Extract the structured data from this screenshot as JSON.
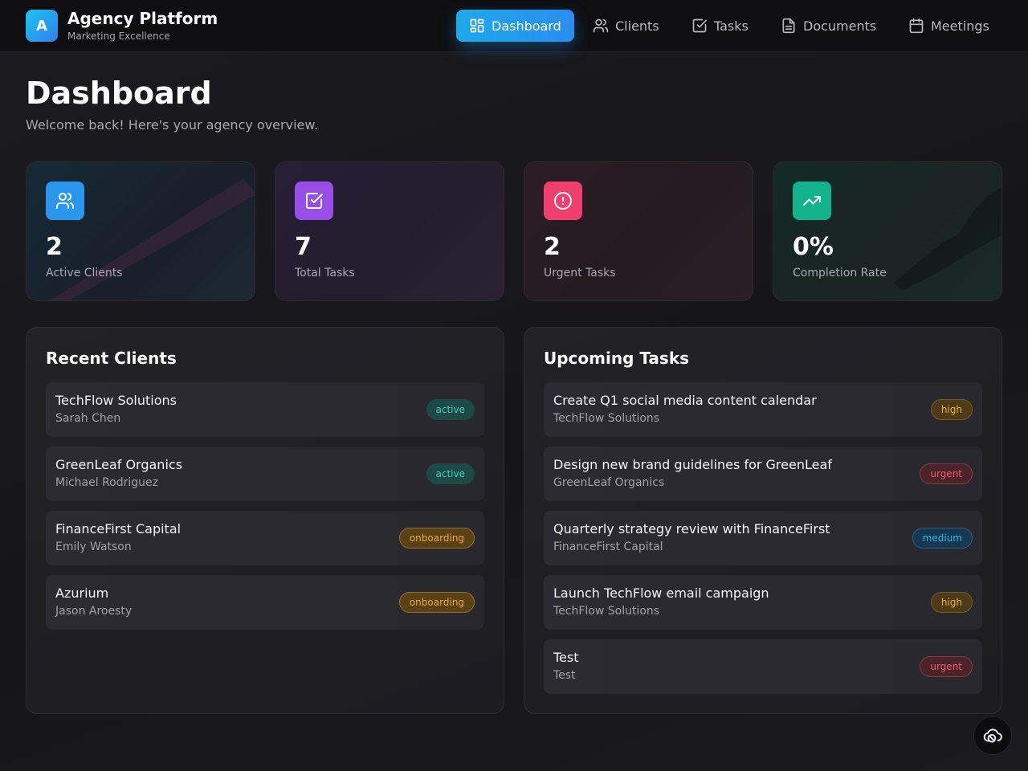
{
  "brand": {
    "logo_letter": "A",
    "title": "Agency Platform",
    "subtitle": "Marketing Excellence"
  },
  "nav": [
    {
      "label": "Dashboard",
      "icon": "layout-grid-icon",
      "active": true
    },
    {
      "label": "Clients",
      "icon": "users-icon",
      "active": false
    },
    {
      "label": "Tasks",
      "icon": "checkbox-icon",
      "active": false
    },
    {
      "label": "Documents",
      "icon": "file-text-icon",
      "active": false
    },
    {
      "label": "Meetings",
      "icon": "calendar-icon",
      "active": false
    }
  ],
  "page": {
    "title": "Dashboard",
    "subtitle": "Welcome back! Here's your agency overview."
  },
  "stats": [
    {
      "value": "2",
      "label": "Active Clients",
      "icon": "users-icon",
      "color": "#2a96ee"
    },
    {
      "value": "7",
      "label": "Total Tasks",
      "icon": "checkbox-icon",
      "color": "#9a4ee8"
    },
    {
      "value": "2",
      "label": "Urgent Tasks",
      "icon": "alert-circle-icon",
      "color": "#ee3f6e"
    },
    {
      "value": "0%",
      "label": "Completion Rate",
      "icon": "trending-up-icon",
      "color": "#12b38c"
    }
  ],
  "recent_clients": {
    "title": "Recent Clients",
    "items": [
      {
        "name": "TechFlow Solutions",
        "contact": "Sarah Chen",
        "status": "active"
      },
      {
        "name": "GreenLeaf Organics",
        "contact": "Michael Rodriguez",
        "status": "active"
      },
      {
        "name": "FinanceFirst Capital",
        "contact": "Emily Watson",
        "status": "onboarding"
      },
      {
        "name": "Azurium",
        "contact": "Jason Aroesty",
        "status": "onboarding"
      }
    ]
  },
  "upcoming_tasks": {
    "title": "Upcoming Tasks",
    "items": [
      {
        "title": "Create Q1 social media content calendar",
        "client": "TechFlow Solutions",
        "priority": "high"
      },
      {
        "title": "Design new brand guidelines for GreenLeaf",
        "client": "GreenLeaf Organics",
        "priority": "urgent"
      },
      {
        "title": "Quarterly strategy review with FinanceFirst",
        "client": "FinanceFirst Capital",
        "priority": "medium"
      },
      {
        "title": "Launch TechFlow email campaign",
        "client": "TechFlow Solutions",
        "priority": "high"
      },
      {
        "title": "Test",
        "client": "Test",
        "priority": "urgent"
      }
    ]
  },
  "fab": {
    "icon": "cloud-off-icon"
  }
}
